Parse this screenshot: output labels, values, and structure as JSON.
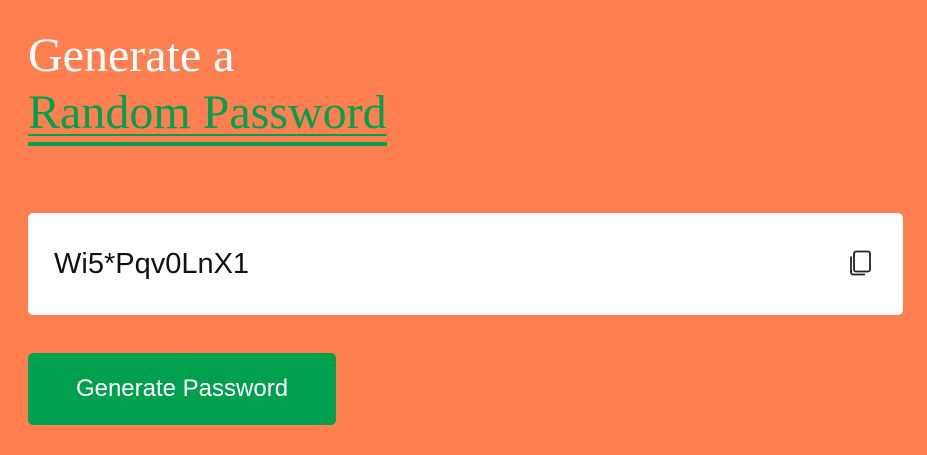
{
  "heading": {
    "line1": "Generate a",
    "line2": "Random Password"
  },
  "password": {
    "value": "Wi5*Pqv0LnX1"
  },
  "copy": {
    "icon": "copy-icon"
  },
  "actions": {
    "generate_label": "Generate Password"
  },
  "colors": {
    "background": "#ff7f50",
    "accent": "#00a04e",
    "heading_text": "#ffffff",
    "input_bg": "#ffffff"
  }
}
